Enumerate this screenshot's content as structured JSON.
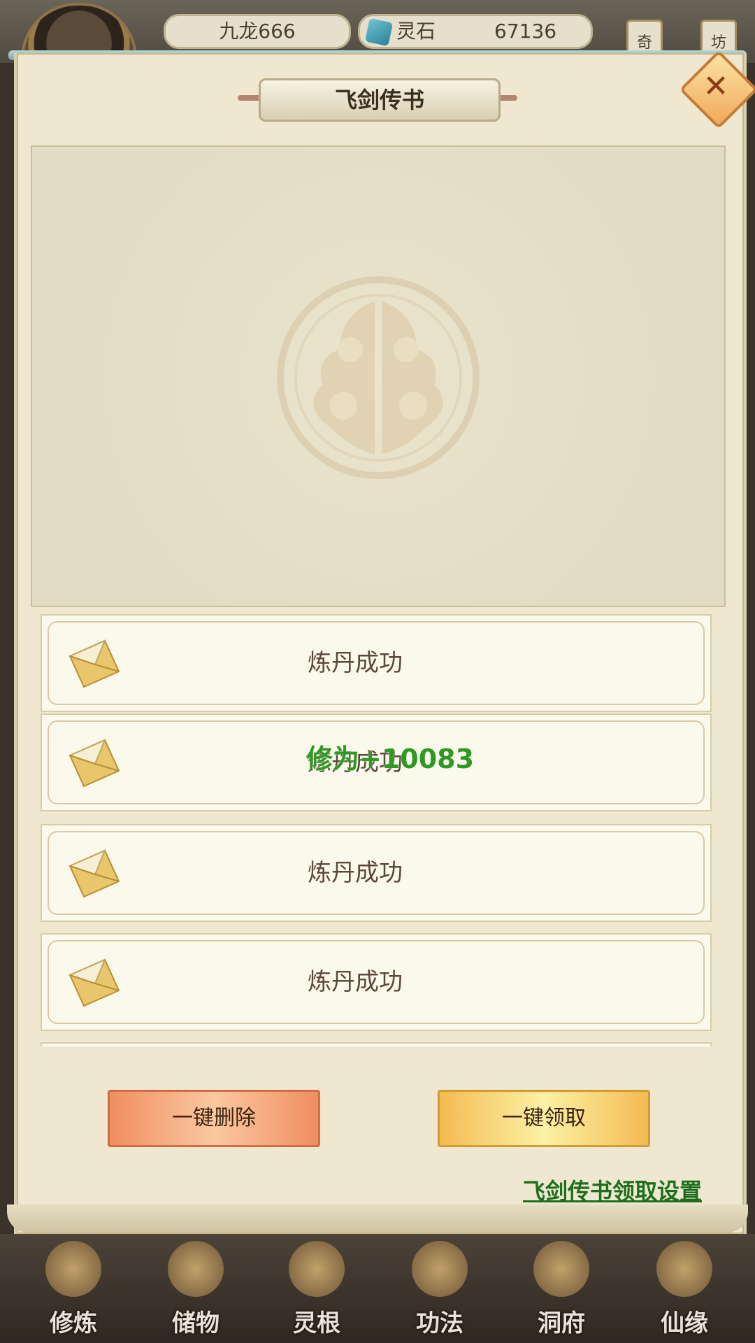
{
  "header": {
    "player_name": "九龙666",
    "currency_label": "灵石",
    "currency_value": "67136",
    "side_tags": [
      "奇",
      "坊"
    ]
  },
  "dialog": {
    "title": "飞剑传书",
    "close_icon": "close-icon"
  },
  "mails": [
    {
      "title": "炼丹成功"
    },
    {
      "title": "炼丹成功"
    },
    {
      "title": "炼丹成功"
    },
    {
      "title": "炼丹成功"
    }
  ],
  "floating_text": "修为+10083",
  "actions": {
    "delete_all": "一键删除",
    "claim_all": "一键领取"
  },
  "settings_link": "飞剑传书领取设置",
  "bottom_nav": {
    "items": [
      {
        "label": "修炼"
      },
      {
        "label": "储物"
      },
      {
        "label": "灵根"
      },
      {
        "label": "功法"
      },
      {
        "label": "洞府"
      },
      {
        "label": "仙缘"
      }
    ]
  },
  "colors": {
    "panel_bg": "#efe7cf",
    "link_green": "#1d6f1d",
    "xp_green": "#2f9a22",
    "delete_orange": "#f08e60",
    "claim_yellow": "#f3bb52"
  }
}
